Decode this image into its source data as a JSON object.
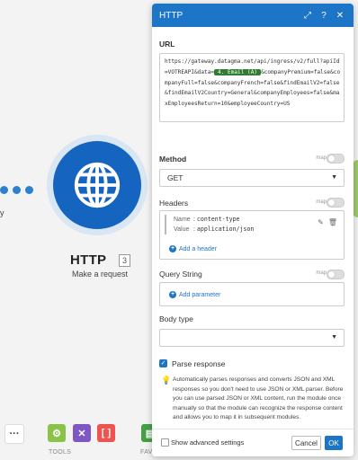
{
  "canvas": {
    "left_label": "y",
    "node": {
      "title": "HTTP",
      "badge": "3",
      "subtitle": "Make a request"
    },
    "toolbar": {
      "more": "···",
      "tools_label": "TOOLS",
      "favorites_label": "FAVORITES"
    }
  },
  "panel": {
    "title": "HTTP",
    "header_icons": [
      "expand-icon",
      "help-icon",
      "close-icon"
    ],
    "url": {
      "label": "URL",
      "before": "https://gateway.datagma.net/api/ingress/v2/full?apiId=VOTREAPI&data=",
      "pill": "4. Email (A)",
      "after": "&companyPremium=false&companyFull=false&companyFrench=false&findEmailV2=false&findEmailV2Country=General&companyEmployees=false&maxEmployeesReturn=10&employeeCountry=US"
    },
    "method": {
      "label": "Method",
      "map": "map",
      "value": "GET"
    },
    "headers": {
      "label": "Headers",
      "map": "map",
      "item": {
        "name_key": "Name",
        "name_value": "content-type",
        "value_key": "Value",
        "value_value": "application/json"
      },
      "add": "Add a header"
    },
    "query": {
      "label": "Query String",
      "map": "map",
      "add": "Add parameter"
    },
    "body": {
      "label": "Body type"
    },
    "parse": {
      "label": "Parse response",
      "info": "Automatically parses responses and converts JSON and XML responses so you don't need to use JSON or XML parser. Before you can use parsed JSON or XML content, run the module once manually so that the module can recognize the response content and allows you to map it in subsequent modules."
    },
    "footer": {
      "advanced": "Show advanced settings",
      "cancel": "Cancel",
      "ok": "OK"
    }
  },
  "colors": {
    "primary": "#1d75c7",
    "node": "#1565c0",
    "pill": "#2e7d32",
    "tip": "#f5a623"
  }
}
